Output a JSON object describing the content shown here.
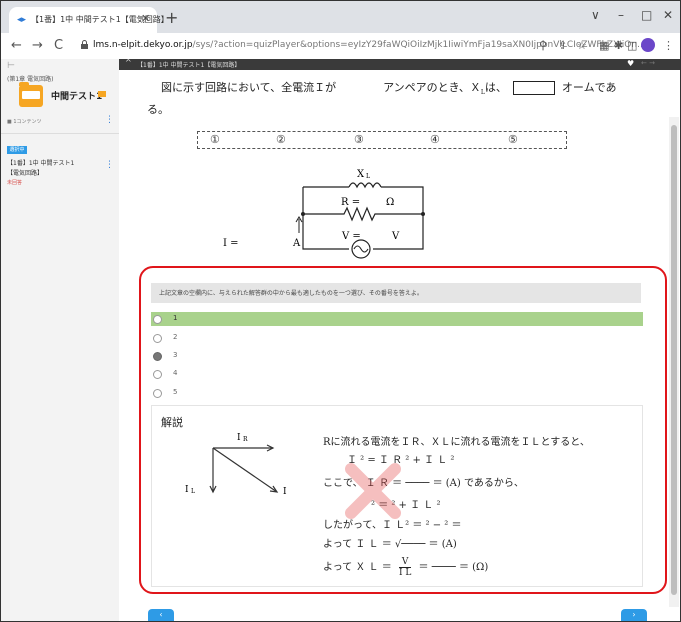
{
  "browser": {
    "tab_title": "【1番】1中 中間テスト1【電気回路】",
    "tab_favicon": "◂▸",
    "new_tab_glyph": "+",
    "url_prefix": "lms.n-elpit.dekyo.or.jp",
    "url_rest": "/sys/?action=quizPlayer&options=eyIzY29faWQiOiIzMjk1IiwiYmFja19saXN0IjpbnVlLCIoZWFkZXIiOn...",
    "window_controls": [
      "∨",
      "–",
      "□",
      "✕"
    ],
    "nav": {
      "back": "←",
      "forward": "→",
      "reload": "C"
    },
    "toolbar_icons": [
      "⚲",
      "⇪",
      "☆",
      "▦",
      "✱",
      "◫",
      "⋮"
    ]
  },
  "sidebar": {
    "back": "⊢",
    "course": "(第1章 電気回路)",
    "title": "中間テスト1",
    "lessons": "■ 1コンテンツ",
    "menu": "⋮",
    "badge": "選択中",
    "item_line1": "【1番】1中 中間テスト1",
    "item_line2": "【電気回路】",
    "status": "未回答"
  },
  "header": {
    "chevron": "^",
    "title": "【1番】1中 中間テスト1【電気回路】",
    "heart": "♥",
    "arrows": "← →"
  },
  "question": {
    "line1_a": "図に示す回路において、全電流Ｉが",
    "line1_b": "アンペアのとき、Ｘ",
    "line1_sub": "L",
    "line1_c": "は、",
    "line1_d": "オームであ",
    "line2": "る。",
    "options": [
      "①",
      "②",
      "③",
      "④",
      "⑤"
    ]
  },
  "circuit": {
    "xl": "X",
    "xl_sub": "L",
    "r_label": "R  =",
    "r_unit": "Ω",
    "i_label": "I  =",
    "i_unit": "A",
    "v_label": "V  =",
    "v_unit": "V"
  },
  "answer": {
    "instruction": "上記文章の空欄内に、与えられた解答群の中から最も適したものを一つ選び、その番号を答えよ。",
    "choices": [
      "1",
      "2",
      "3",
      "4",
      "5"
    ],
    "selected_index": 0,
    "filled_index": 2
  },
  "explanation": {
    "title": "解説",
    "ir": "I",
    "ir_sub": "R",
    "il": "I",
    "il_sub": "L",
    "i": "I",
    "line1": "Rに流れる電流をＩ",
    "line1_b": "Ｒ、Ｘ",
    "line1_c": "Ｌに流れる電流をＩ",
    "line1_d": "Ｌとすると、",
    "line2": "Ｉ ² = Ｉ Ｒ ² + Ｉ Ｌ ²",
    "line3": "ここで、 Ｉ Ｒ  ＝  ──── ＝        (A)    であるから、",
    "line4": "²  ＝          ²  + Ｉ Ｌ ²",
    "line5": "したがって、Ｉ Ｌ² ＝         ² −       ²  ＝",
    "line6": "よって   Ｉ Ｌ ＝ √────   ＝           (A)",
    "line7a": "よって   Ｘ Ｌ ＝",
    "frac_num": "V",
    "frac_den": "I L",
    "line7b": "＝  ────   ＝   (Ω)"
  },
  "pager": {
    "prev": "‹",
    "next": "›"
  },
  "colors": {
    "highlight": "#e0151a",
    "selected_row": "#a9d28c",
    "accent": "#2e9be6"
  }
}
